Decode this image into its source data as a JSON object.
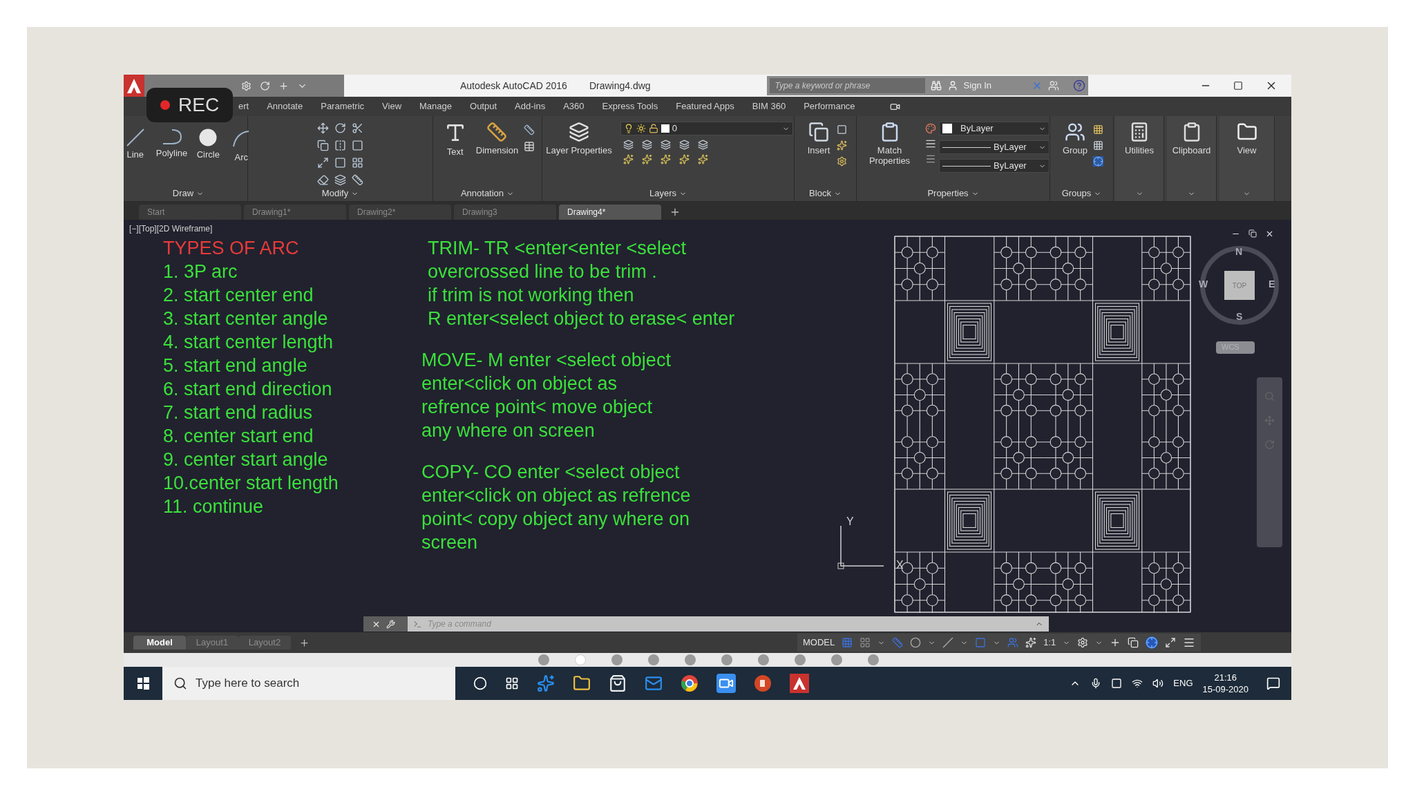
{
  "title_bar": {
    "app_title": "Autodesk AutoCAD 2016",
    "file_name": "Drawing4.dwg",
    "search_placeholder": "Type a keyword or phrase",
    "sign_in": "Sign In"
  },
  "recording_badge": {
    "label": "REC"
  },
  "menu_tabs": [
    {
      "label": "ert",
      "selected": false
    },
    {
      "label": "Annotate",
      "selected": false
    },
    {
      "label": "Parametric",
      "selected": false
    },
    {
      "label": "View",
      "selected": false
    },
    {
      "label": "Manage",
      "selected": false
    },
    {
      "label": "Output",
      "selected": false
    },
    {
      "label": "Add-ins",
      "selected": false
    },
    {
      "label": "A360",
      "selected": false
    },
    {
      "label": "Express Tools",
      "selected": false
    },
    {
      "label": "Featured Apps",
      "selected": false
    },
    {
      "label": "BIM 360",
      "selected": false
    },
    {
      "label": "Performance",
      "selected": false
    }
  ],
  "ribbon_panels": [
    {
      "kind": "draw",
      "title": "Draw",
      "tools": [
        "Line",
        "Polyline",
        "Circle",
        "Arc"
      ]
    },
    {
      "kind": "modify",
      "title": "Modify"
    },
    {
      "kind": "annotation",
      "title": "Annotation",
      "tools": [
        "Text",
        "Dimension"
      ]
    },
    {
      "kind": "layers",
      "title": "Layers",
      "tools": [
        "Layer Properties"
      ],
      "layer": "0"
    },
    {
      "kind": "block",
      "title": "Block",
      "tools": [
        "Insert"
      ]
    },
    {
      "kind": "properties",
      "title": "Properties",
      "tools": [
        "Match Properties"
      ],
      "dropdowns": [
        "ByLayer",
        "ByLayer",
        "ByLayer"
      ]
    },
    {
      "kind": "groups",
      "title": "Groups",
      "tools": [
        "Group"
      ]
    },
    {
      "kind": "utilities",
      "tools": [
        "Utilities"
      ]
    },
    {
      "kind": "clipboard",
      "tools": [
        "Clipboard"
      ]
    },
    {
      "kind": "view",
      "tools": [
        "View"
      ]
    }
  ],
  "file_tabs": [
    {
      "label": "Start",
      "selected": false
    },
    {
      "label": "Drawing1*",
      "selected": false
    },
    {
      "label": "Drawing2*",
      "selected": false
    },
    {
      "label": "Drawing3",
      "selected": false
    },
    {
      "label": "Drawing4*",
      "selected": true
    }
  ],
  "drawing": {
    "viewport_label": "[−][Top][2D Wireframe]",
    "heading": "TYPES OF ARC",
    "arc_types": [
      "1. 3P arc",
      "2. start center end",
      "3. start center angle",
      "4. start center length",
      "5. start end angle",
      "6. start end direction",
      "7. start end radius",
      "8. center start end",
      "9. center start angle",
      "10.center start length",
      "11. continue"
    ],
    "notes": [
      {
        "lines": [
          "TRIM- TR <enter<enter <select",
          "overcrossed line to be trim .",
          "if trim is not working then",
          "R enter<select object to erase< enter"
        ]
      },
      {
        "lines": [
          "MOVE- M enter <select object",
          "enter<click on object as",
          "refrence point< move object",
          "any where on screen"
        ]
      },
      {
        "lines": [
          "COPY- CO enter <select object",
          "enter<click on object as refrence",
          "point< copy object any where on",
          "screen"
        ]
      }
    ],
    "axis": {
      "y": "Y",
      "x": "X"
    },
    "view_cube": {
      "north": "N",
      "south": "S",
      "east": "E",
      "west": "W",
      "face": "TOP",
      "ucs": "WCS"
    }
  },
  "command_line": {
    "placeholder": "Type a command"
  },
  "layout_tabs": [
    {
      "label": "Model",
      "selected": true
    },
    {
      "label": "Layout1",
      "selected": false
    },
    {
      "label": "Layout2",
      "selected": false
    }
  ],
  "status_bar": {
    "mode": "MODEL",
    "scale": "1:1"
  },
  "slide_dots": [
    {
      "selected": false
    },
    {
      "selected": true
    },
    {
      "selected": false
    },
    {
      "selected": false
    },
    {
      "selected": false
    },
    {
      "selected": false
    },
    {
      "selected": false
    },
    {
      "selected": false
    },
    {
      "selected": false
    },
    {
      "selected": false
    }
  ],
  "taskbar": {
    "search_placeholder": "Type here to search",
    "language": "ENG",
    "time": "21:16",
    "date": "15-09-2020"
  }
}
